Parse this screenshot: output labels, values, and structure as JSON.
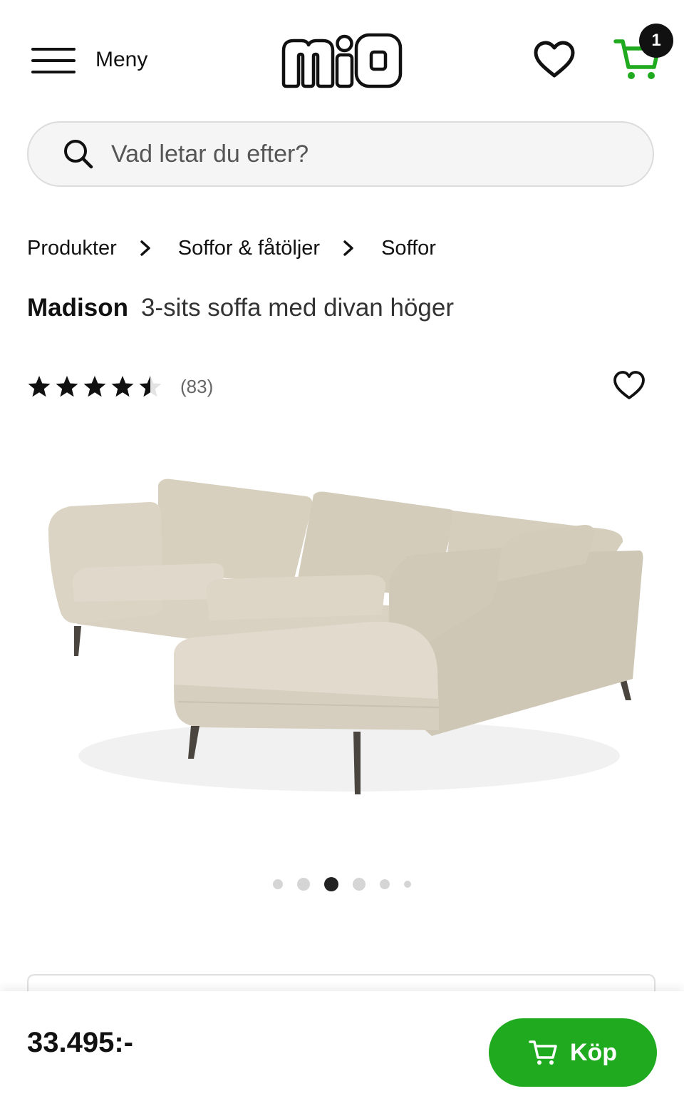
{
  "header": {
    "menu_label": "Meny",
    "logo_text": "mio",
    "cart_count": "1",
    "accent_color": "#1faa1f"
  },
  "search": {
    "placeholder": "Vad letar du efter?",
    "value": ""
  },
  "breadcrumb": [
    {
      "label": "Produkter"
    },
    {
      "label": "Soffor & fåtöljer"
    },
    {
      "label": "Soffor"
    }
  ],
  "product": {
    "brand": "Madison",
    "description": "3-sits soffa med divan höger",
    "rating": 4.5,
    "rating_max": 5,
    "review_count": "(83)",
    "image_icon": "corner-sofa-image",
    "gallery": {
      "total": 6,
      "active_index": 2
    }
  },
  "buy_bar": {
    "price": "33.495:-",
    "buy_label": "Köp",
    "button_color": "#1faa1f"
  }
}
